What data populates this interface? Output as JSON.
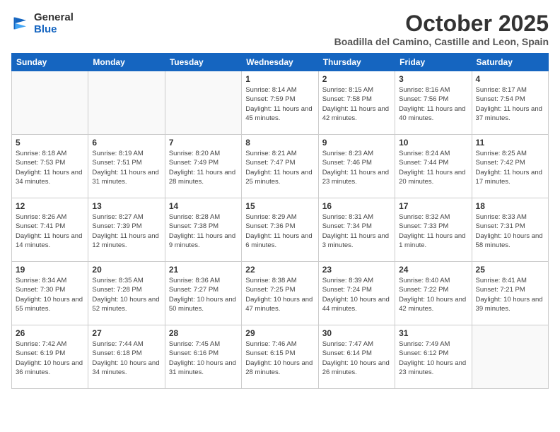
{
  "header": {
    "logo_general": "General",
    "logo_blue": "Blue",
    "month": "October 2025",
    "location": "Boadilla del Camino, Castille and Leon, Spain"
  },
  "days_of_week": [
    "Sunday",
    "Monday",
    "Tuesday",
    "Wednesday",
    "Thursday",
    "Friday",
    "Saturday"
  ],
  "weeks": [
    [
      {
        "day": "",
        "info": ""
      },
      {
        "day": "",
        "info": ""
      },
      {
        "day": "",
        "info": ""
      },
      {
        "day": "1",
        "info": "Sunrise: 8:14 AM\nSunset: 7:59 PM\nDaylight: 11 hours and 45 minutes."
      },
      {
        "day": "2",
        "info": "Sunrise: 8:15 AM\nSunset: 7:58 PM\nDaylight: 11 hours and 42 minutes."
      },
      {
        "day": "3",
        "info": "Sunrise: 8:16 AM\nSunset: 7:56 PM\nDaylight: 11 hours and 40 minutes."
      },
      {
        "day": "4",
        "info": "Sunrise: 8:17 AM\nSunset: 7:54 PM\nDaylight: 11 hours and 37 minutes."
      }
    ],
    [
      {
        "day": "5",
        "info": "Sunrise: 8:18 AM\nSunset: 7:53 PM\nDaylight: 11 hours and 34 minutes."
      },
      {
        "day": "6",
        "info": "Sunrise: 8:19 AM\nSunset: 7:51 PM\nDaylight: 11 hours and 31 minutes."
      },
      {
        "day": "7",
        "info": "Sunrise: 8:20 AM\nSunset: 7:49 PM\nDaylight: 11 hours and 28 minutes."
      },
      {
        "day": "8",
        "info": "Sunrise: 8:21 AM\nSunset: 7:47 PM\nDaylight: 11 hours and 25 minutes."
      },
      {
        "day": "9",
        "info": "Sunrise: 8:23 AM\nSunset: 7:46 PM\nDaylight: 11 hours and 23 minutes."
      },
      {
        "day": "10",
        "info": "Sunrise: 8:24 AM\nSunset: 7:44 PM\nDaylight: 11 hours and 20 minutes."
      },
      {
        "day": "11",
        "info": "Sunrise: 8:25 AM\nSunset: 7:42 PM\nDaylight: 11 hours and 17 minutes."
      }
    ],
    [
      {
        "day": "12",
        "info": "Sunrise: 8:26 AM\nSunset: 7:41 PM\nDaylight: 11 hours and 14 minutes."
      },
      {
        "day": "13",
        "info": "Sunrise: 8:27 AM\nSunset: 7:39 PM\nDaylight: 11 hours and 12 minutes."
      },
      {
        "day": "14",
        "info": "Sunrise: 8:28 AM\nSunset: 7:38 PM\nDaylight: 11 hours and 9 minutes."
      },
      {
        "day": "15",
        "info": "Sunrise: 8:29 AM\nSunset: 7:36 PM\nDaylight: 11 hours and 6 minutes."
      },
      {
        "day": "16",
        "info": "Sunrise: 8:31 AM\nSunset: 7:34 PM\nDaylight: 11 hours and 3 minutes."
      },
      {
        "day": "17",
        "info": "Sunrise: 8:32 AM\nSunset: 7:33 PM\nDaylight: 11 hours and 1 minute."
      },
      {
        "day": "18",
        "info": "Sunrise: 8:33 AM\nSunset: 7:31 PM\nDaylight: 10 hours and 58 minutes."
      }
    ],
    [
      {
        "day": "19",
        "info": "Sunrise: 8:34 AM\nSunset: 7:30 PM\nDaylight: 10 hours and 55 minutes."
      },
      {
        "day": "20",
        "info": "Sunrise: 8:35 AM\nSunset: 7:28 PM\nDaylight: 10 hours and 52 minutes."
      },
      {
        "day": "21",
        "info": "Sunrise: 8:36 AM\nSunset: 7:27 PM\nDaylight: 10 hours and 50 minutes."
      },
      {
        "day": "22",
        "info": "Sunrise: 8:38 AM\nSunset: 7:25 PM\nDaylight: 10 hours and 47 minutes."
      },
      {
        "day": "23",
        "info": "Sunrise: 8:39 AM\nSunset: 7:24 PM\nDaylight: 10 hours and 44 minutes."
      },
      {
        "day": "24",
        "info": "Sunrise: 8:40 AM\nSunset: 7:22 PM\nDaylight: 10 hours and 42 minutes."
      },
      {
        "day": "25",
        "info": "Sunrise: 8:41 AM\nSunset: 7:21 PM\nDaylight: 10 hours and 39 minutes."
      }
    ],
    [
      {
        "day": "26",
        "info": "Sunrise: 7:42 AM\nSunset: 6:19 PM\nDaylight: 10 hours and 36 minutes."
      },
      {
        "day": "27",
        "info": "Sunrise: 7:44 AM\nSunset: 6:18 PM\nDaylight: 10 hours and 34 minutes."
      },
      {
        "day": "28",
        "info": "Sunrise: 7:45 AM\nSunset: 6:16 PM\nDaylight: 10 hours and 31 minutes."
      },
      {
        "day": "29",
        "info": "Sunrise: 7:46 AM\nSunset: 6:15 PM\nDaylight: 10 hours and 28 minutes."
      },
      {
        "day": "30",
        "info": "Sunrise: 7:47 AM\nSunset: 6:14 PM\nDaylight: 10 hours and 26 minutes."
      },
      {
        "day": "31",
        "info": "Sunrise: 7:49 AM\nSunset: 6:12 PM\nDaylight: 10 hours and 23 minutes."
      },
      {
        "day": "",
        "info": ""
      }
    ]
  ]
}
